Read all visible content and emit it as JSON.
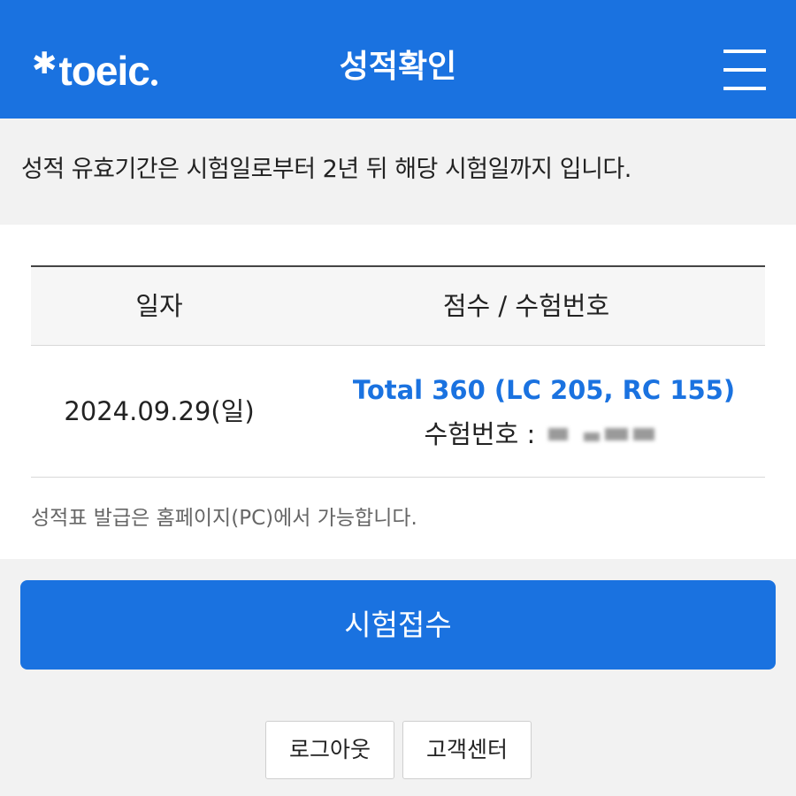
{
  "header": {
    "logo_text": "toeic",
    "title": "성적확인",
    "menu_icon": "hamburger-menu-icon"
  },
  "notice": {
    "text": "성적 유효기간은 시험일로부터 2년 뒤 해당 시험일까지 입니다."
  },
  "table": {
    "columns": [
      "일자",
      "점수 / 수험번호"
    ],
    "rows": [
      {
        "date": "2024.09.29(일)",
        "score": "Total 360 (LC 205, RC 155)",
        "exam_number_label": "수험번호 :"
      }
    ]
  },
  "footnote": "성적표 발급은 홈페이지(PC)에서 가능합니다.",
  "primary_button": "시험접수",
  "footer_buttons": {
    "logout": "로그아웃",
    "support": "고객센터"
  },
  "colors": {
    "brand": "#1a72e0",
    "background": "#f2f2f2",
    "text": "#222222"
  }
}
